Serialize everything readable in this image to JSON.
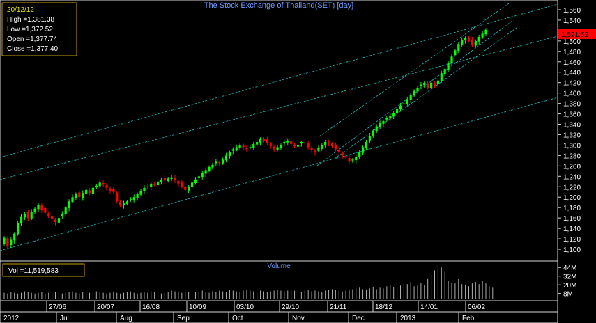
{
  "title": "The Stock Exchange of Thailand(SET) [day]",
  "info_box": {
    "date": "20/12/12",
    "high": "High  =1,381.38",
    "low": "Low  =1,372.52",
    "open": "Open  =1,377.74",
    "close": "Close  =1,377.40"
  },
  "last_price_label": "1,521.52",
  "volume_panel": {
    "title": "Volume",
    "readout": "Vol  =11,519,583",
    "axis_ticks": [
      "44M",
      "32M",
      "20M",
      "8M"
    ]
  },
  "x_axis": {
    "date_labels": [
      "27/06",
      "20/07",
      "16/08",
      "10/09",
      "03/10",
      "29/10",
      "21/11",
      "18/12",
      "14/01",
      "06/02"
    ],
    "month_labels": [
      "2012",
      "Jul",
      "Aug",
      "Sep",
      "Oct",
      "Nov",
      "Dec",
      "2013",
      "Feb"
    ]
  },
  "colors": {
    "background": "#000000",
    "up_candle": "#00ff00",
    "down_candle": "#ff0000",
    "trendline": "#20c0c0",
    "title_text": "#6c9cff",
    "axis_text": "#ffffff",
    "info_border": "#c8a000",
    "price_tag": "#ff0000"
  },
  "chart_data": {
    "type": "candlestick",
    "y_axis": {
      "ticks": [
        1100,
        1120,
        1140,
        1160,
        1180,
        1200,
        1220,
        1240,
        1260,
        1280,
        1300,
        1320,
        1340,
        1360,
        1380,
        1400,
        1420,
        1440,
        1460,
        1480,
        1500,
        1520,
        1540,
        1560
      ],
      "range": [
        1088,
        1568
      ]
    },
    "grid": false,
    "closes": [
      1122,
      1105,
      1118,
      1130,
      1150,
      1162,
      1168,
      1160,
      1172,
      1178,
      1185,
      1176,
      1170,
      1164,
      1158,
      1152,
      1160,
      1168,
      1180,
      1192,
      1200,
      1206,
      1200,
      1208,
      1214,
      1208,
      1218,
      1222,
      1228,
      1224,
      1218,
      1212,
      1210,
      1192,
      1185,
      1188,
      1192,
      1196,
      1200,
      1206,
      1212,
      1218,
      1220,
      1226,
      1224,
      1230,
      1234,
      1232,
      1236,
      1238,
      1232,
      1226,
      1220,
      1214,
      1220,
      1228,
      1234,
      1240,
      1246,
      1252,
      1258,
      1262,
      1268,
      1266,
      1272,
      1280,
      1286,
      1292,
      1296,
      1300,
      1296,
      1292,
      1296,
      1302,
      1306,
      1312,
      1308,
      1304,
      1298,
      1292,
      1296,
      1300,
      1306,
      1308,
      1302,
      1298,
      1300,
      1306,
      1304,
      1296,
      1290,
      1286,
      1294,
      1300,
      1306,
      1304,
      1298,
      1292,
      1286,
      1280,
      1276,
      1268,
      1272,
      1278,
      1286,
      1296,
      1306,
      1318,
      1328,
      1336,
      1342,
      1346,
      1352,
      1356,
      1362,
      1370,
      1376,
      1380,
      1388,
      1396,
      1404,
      1410,
      1416,
      1420,
      1410,
      1420,
      1414,
      1424,
      1438,
      1446,
      1458,
      1470,
      1482,
      1494,
      1502,
      1506,
      1500,
      1492,
      1500,
      1508,
      1514,
      1521.52
    ],
    "volumes": [
      9,
      8,
      10,
      9,
      8,
      9,
      11,
      10,
      9,
      8,
      9,
      10,
      8,
      9,
      9,
      10,
      9,
      8,
      9,
      10,
      11,
      9,
      8,
      10,
      9,
      9,
      10,
      11,
      10,
      9,
      8,
      9,
      10,
      9,
      8,
      9,
      10,
      11,
      9,
      8,
      9,
      10,
      9,
      11,
      10,
      9,
      8,
      9,
      10,
      12,
      11,
      10,
      9,
      11,
      10,
      9,
      10,
      11,
      12,
      10,
      9,
      11,
      10,
      12,
      11,
      10,
      13,
      12,
      11,
      10,
      12,
      13,
      12,
      11,
      10,
      12,
      11,
      10,
      11,
      12,
      13,
      12,
      11,
      12,
      13,
      12,
      11,
      10,
      12,
      13,
      11,
      12,
      11,
      10,
      12,
      13,
      14,
      13,
      12,
      11,
      12,
      13,
      14,
      15,
      16,
      14,
      13,
      15,
      17,
      14,
      16,
      15,
      18,
      20,
      17,
      16,
      19,
      22,
      21,
      24,
      18,
      19,
      22,
      20,
      28,
      34,
      40,
      48,
      44,
      38,
      26,
      23,
      22,
      28,
      21,
      20,
      18,
      22,
      24,
      21,
      26,
      22,
      18,
      16
    ]
  }
}
